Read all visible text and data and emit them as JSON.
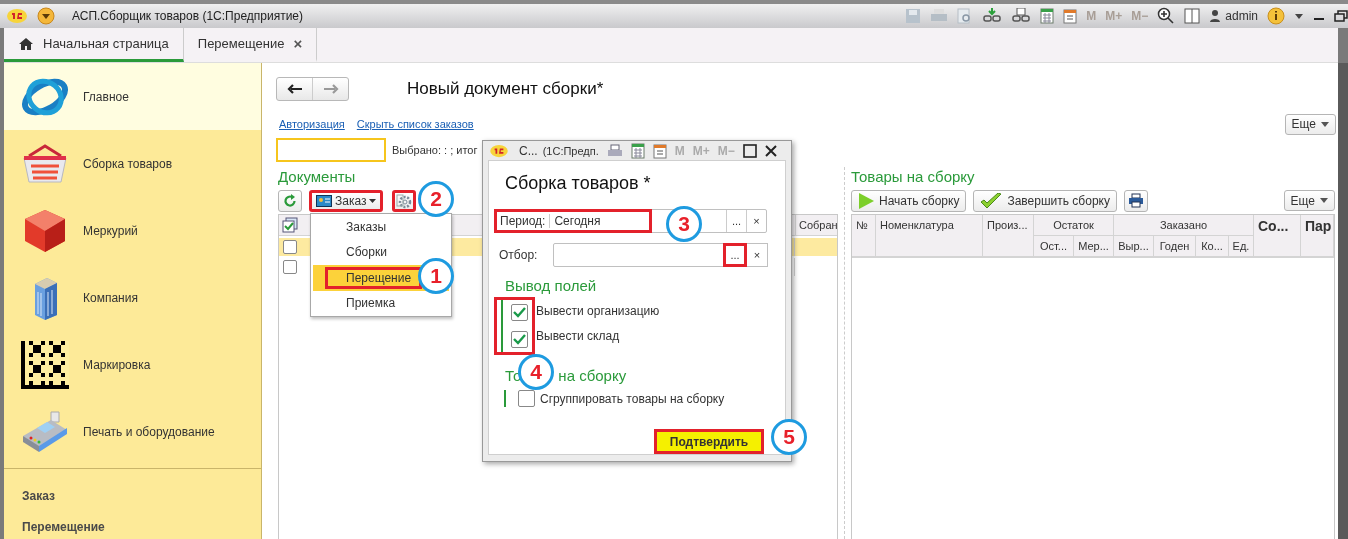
{
  "window": {
    "title": "АСП.Сборщик товаров  (1С:Предприятие)",
    "memory_buttons": [
      "M",
      "M+",
      "M−"
    ],
    "user": "admin"
  },
  "tabs": [
    {
      "label": "Начальная страница",
      "selected": true,
      "kind": "home"
    },
    {
      "label": "Перемещение",
      "selected": false,
      "kind": "document",
      "close": "×"
    }
  ],
  "sidebar": {
    "items": [
      {
        "label": "Главное",
        "selected": true,
        "kind": "globe"
      },
      {
        "label": "Сборка товаров",
        "selected": false,
        "kind": "basket"
      },
      {
        "label": "Меркурий",
        "selected": false,
        "kind": "cube"
      },
      {
        "label": "Компания",
        "selected": false,
        "kind": "building"
      },
      {
        "label": "Маркировка",
        "selected": false,
        "kind": "datamatrix"
      },
      {
        "label": "Печать и оборудование",
        "selected": false,
        "kind": "terminal"
      }
    ],
    "links": [
      "Заказ",
      "Перемещение"
    ]
  },
  "page": {
    "title": "Новый документ сборки*",
    "links": [
      "Авторизация",
      "Скрыть список заказов"
    ],
    "more_button": "Еще",
    "selection_info": "Выбрано: : ; итог"
  },
  "documents": {
    "title": "Документы",
    "filter_button": {
      "label": "Заказ",
      "highlighted": true
    },
    "settings_button": {
      "highlighted": true
    },
    "columns": [
      "Собран"
    ],
    "rows": [
      {
        "checked": false,
        "selected": true
      },
      {
        "checked": false,
        "selected": false
      }
    ],
    "menu": [
      {
        "label": "Заказы",
        "selected": false,
        "highlighted": false
      },
      {
        "label": "Сборки",
        "selected": false,
        "highlighted": false
      },
      {
        "label": "Перещение",
        "selected": true,
        "highlighted": true
      },
      {
        "label": "Приемка",
        "selected": false,
        "highlighted": false
      }
    ]
  },
  "dialog": {
    "title": "С...",
    "app": "(1С:Предп.",
    "memory_buttons": [
      "M",
      "M+",
      "M−"
    ],
    "heading": "Сборка товаров *",
    "period": {
      "label": "Период:",
      "value": "Сегодня",
      "highlighted": true,
      "choose": "...",
      "clear": "×"
    },
    "filter": {
      "label": "Отбор:",
      "choose": "...",
      "clear": "×",
      "choose_highlighted": true
    },
    "fields_title": "Вывод полей",
    "fields_highlighted": true,
    "options": [
      {
        "label": "Вывести организацию",
        "checked": true
      },
      {
        "label": "Вывести склад",
        "checked": true
      }
    ],
    "goods_title_parts": [
      "То",
      "на сборку"
    ],
    "group_option": {
      "label": "Сгруппировать товары на сборку",
      "checked": false
    },
    "confirm_button": {
      "label": "Подтвердить",
      "highlighted": true
    }
  },
  "goods": {
    "title": "Товары на сборку",
    "buttons": [
      "Начать сборку",
      "Завершить сборку"
    ],
    "more_button": "Еще",
    "columns": [
      {
        "label": "№",
        "bold": false
      },
      {
        "label": "Номенклатура",
        "bold": false
      },
      {
        "label": "Произ...",
        "bold": false
      },
      {
        "label": "Остаток",
        "bold": false,
        "children": [
          {
            "label": "Ост..."
          },
          {
            "label": "Мер..."
          }
        ]
      },
      {
        "label": "Заказано",
        "bold": false,
        "children": [
          {
            "label": "Выр..."
          },
          {
            "label": "Годен"
          },
          {
            "label": "Ко..."
          },
          {
            "label": "Ед."
          }
        ]
      },
      {
        "label": "Со...",
        "bold": true
      },
      {
        "label": "Пар",
        "bold": true
      }
    ]
  },
  "annotations": [
    {
      "label": "1"
    },
    {
      "label": "2"
    },
    {
      "label": "3"
    },
    {
      "label": "4"
    },
    {
      "label": "5"
    }
  ]
}
